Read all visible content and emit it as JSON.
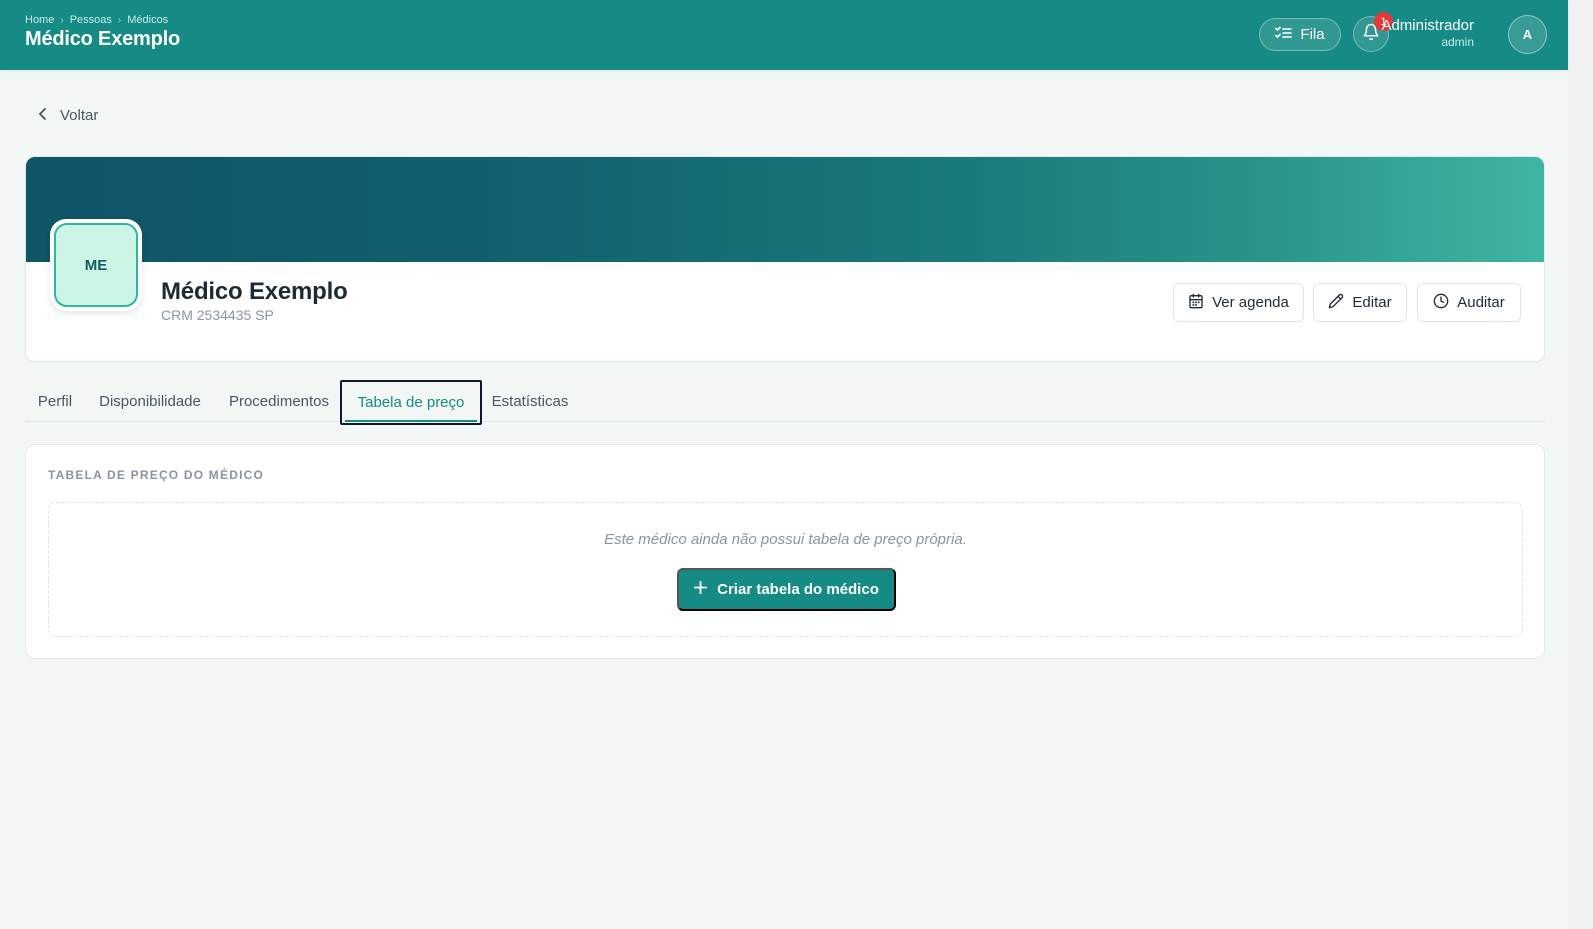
{
  "header": {
    "breadcrumb": [
      "Home",
      "Pessoas",
      "Médicos"
    ],
    "breadcrumb_separator": "›",
    "title": "Médico Exemplo",
    "fila_label": "Fila",
    "notification_count": "1",
    "user_name": "Administrador",
    "user_role": "admin",
    "avatar_initial": "A"
  },
  "back_label": "Voltar",
  "profile": {
    "initials": "ME",
    "name": "Médico Exemplo",
    "crm": "CRM 2534435 SP",
    "actions": {
      "agenda": "Ver agenda",
      "editar": "Editar",
      "auditar": "Auditar"
    }
  },
  "tabs": [
    {
      "label": "Perfil"
    },
    {
      "label": "Disponibilidade"
    },
    {
      "label": "Procedimentos"
    },
    {
      "label": "Tabela de preço",
      "active": true
    },
    {
      "label": "Estatísticas"
    }
  ],
  "price_table": {
    "section_title": "TABELA DE PREÇO DO MÉDICO",
    "empty_message": "Este médico ainda não possui tabela de preço própria.",
    "create_button": "Criar tabela do médico"
  },
  "colors": {
    "primary": "#168a84",
    "badge": "#e5383b",
    "avatar_bg": "#cdf5e6"
  }
}
